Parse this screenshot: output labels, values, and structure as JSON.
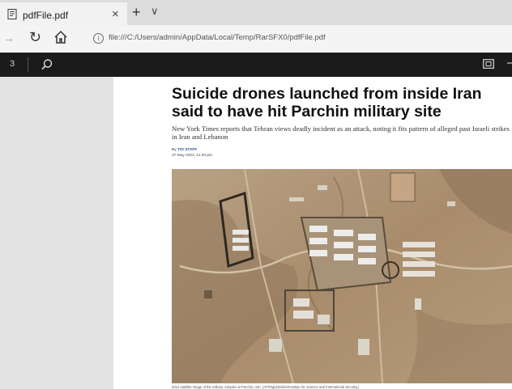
{
  "browser": {
    "tab_title": "pdfFile.pdf",
    "tab_close": "×",
    "new_tab": "+",
    "tab_list": "∨",
    "url": "file:///C:/Users/admin/AppData/Local/Temp/RarSFX0/pdfFile.pdf",
    "url_info_icon": "i"
  },
  "pdf_toolbar": {
    "page_number": "3"
  },
  "article": {
    "headline": "Suicide drones launched from inside Iran said to have hit Parchin military site",
    "subheadline": "New York Times reports that Tehran views deadly incident as an attack, noting it fits pattern of alleged past Israeli strikes in Iran and Lebanon",
    "byline_prefix": "By",
    "author": "TOI STAFF",
    "date": "27 May 2022, 11:33 pm",
    "photo_caption": "2014 satellite image of the military complex at Parchin, Iran. (AP/DigitalGlobe/Institute for Science and International Security)"
  },
  "icons": {
    "pdf": "pdf-file-icon",
    "back": "back-arrow-icon",
    "refresh": "refresh-icon",
    "home": "home-icon",
    "search": "search-icon",
    "fit": "fit-page-icon",
    "more": "more-icon"
  }
}
